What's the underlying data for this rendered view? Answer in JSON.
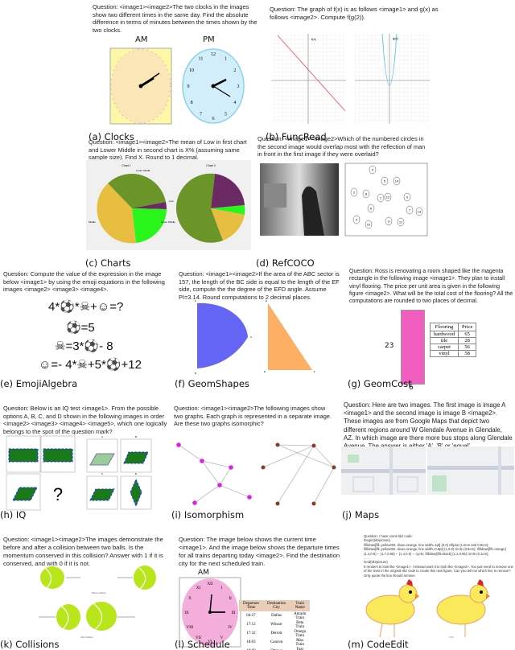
{
  "panels": {
    "clocks": {
      "question": "Question: <image1><image2>The two clocks in the images show two different times in the same day. Find the absolute difference in terms of minutes between the times shown by the two clocks.",
      "label_am": "AM",
      "label_pm": "PM",
      "numbers": [
        "12",
        "1",
        "2",
        "3",
        "4",
        "5",
        "6",
        "7",
        "8",
        "9",
        "10",
        "11"
      ],
      "caption": "(a) Clocks"
    },
    "funcread": {
      "question": "Question: The graph of f(x) is as follows <image1> and g(x) as follows <image2>. Compute f(g(2)).",
      "f_label": "f(x)",
      "g_label": "g(x)",
      "caption": "(b) FuncRead"
    },
    "charts": {
      "question": "Question: <image1><image2>The mean of Low in first chart and Lower Middle in second chart is X% (assuming same sample size). Find X. Round to 1 decimal.",
      "chart1_title": "Chart 1",
      "chart2_title": "Chart 2",
      "labels": [
        "Lower Middle",
        "Low",
        "Upper Middle",
        "Middle"
      ],
      "caption": "(c) Charts"
    },
    "refcoco": {
      "question": "Question: <image1><image2>Which of the numbered circles in the second image would overlap most with the reflection of man in front in the first image if they were overlaid?",
      "circles": [
        "9",
        "5",
        "14",
        "2",
        "8",
        "1",
        "12",
        "0",
        "6",
        "7",
        "13",
        "4",
        "10",
        "3",
        "11"
      ],
      "caption": "(d) RefCOCO"
    },
    "emoji": {
      "question": "Question: Compute the value of the expression in the image below <image1> by using the emoji equations in the following images <image2> <image3> <image4>.",
      "equations": [
        "4*⚽*☠+☺=?",
        "⚽=5",
        "☠=3*⚽- 8",
        "☺=- 4*☠+5*⚽+12"
      ],
      "caption": "(e) EmojiAlgebra"
    },
    "geomshapes": {
      "question": "Question: <image1><image2>If the area of the ABC sector is 157, the length of the BC side is equal to the length of the EF side, compute the the degree of the EFD angle. Assume PI=3.14. Round computations to 2 decimal places.",
      "points": [
        "C",
        "A",
        "B",
        "E",
        "D",
        "F"
      ],
      "caption": "(f) GeomShapes"
    },
    "geomcost": {
      "question": "Question: Ross is renovating a room shaped like the magenta rectangle in the following image <image1>. They plan to install vinyl flooring. The price per unit area is given in the following figure <image2>. What will be the total cost of the flooring? All the computations are rounded to two places of decimal.",
      "height": "23",
      "width": "6",
      "table": {
        "headers": [
          "Flooring",
          "Price"
        ],
        "rows": [
          [
            "hardwood",
            "65"
          ],
          [
            "tile",
            "28"
          ],
          [
            "carpet",
            "56"
          ],
          [
            "vinyl",
            "58"
          ]
        ]
      },
      "caption": "(g) GeomCost"
    },
    "iq": {
      "question": "Question: Below is an IQ test <image1>. From the possible options A, B, C, and D shown in the following images in order <image2> <image3> <image4> <image5>, which one logically belongs to the spot of the question mark?",
      "mark": "?",
      "options": [
        "A",
        "B",
        "C",
        "D"
      ],
      "caption": "(h) IQ"
    },
    "isomorphism": {
      "question": "Question: <image1><image2>The following images show two graphs. Each graph is represented in a separate image. Are these two graphs isomorphic?",
      "caption": "(i) Isomorphism"
    },
    "maps": {
      "question": "Question: Here are two images. The first image is image A <image1> and the second image is image B <image2>. These images are from Google Maps that depict two different regions around W Glendale Avenue in Glendale, AZ. In which image are there more bus stops along Glendale Avenue. The answer is either 'A', 'B' or 'equal'.",
      "caption": "(j) Maps"
    },
    "collisions": {
      "question": "Question: <image1><image2>The images demonstrate the before and after a collision between two balls. Is the momentum conserved in this collision? Answer with 1 if it is conserved, and with 0 if it is not.",
      "before_label": "Before Collision",
      "after_label": "After Collision",
      "caption": "(k) Collisions"
    },
    "schedule": {
      "question": "Question: The image below shows the current time <image1>. And the image below shows the departure times for all trains departing today <image2>. Find the destination city for the next scheduled train.",
      "label_am": "AM",
      "numerals": [
        "XII",
        "I",
        "II",
        "III",
        "IV",
        "V",
        "VI",
        "VII",
        "VIII",
        "IX",
        "X",
        "XI"
      ],
      "table": {
        "headers": [
          "Departure Time",
          "Destination City",
          "Train Name"
        ],
        "rows": [
          [
            "04:27",
            "Dallas",
            "Amarin Train"
          ],
          [
            "17:12",
            "Winsor",
            "Beta Train"
          ],
          [
            "17:32",
            "Detroit",
            "Omega Train"
          ],
          [
            "18:03",
            "Cancun",
            "Max Train"
          ],
          [
            "18:09",
            "Ottawa",
            "Fast Train"
          ],
          [
            "20:21",
            "Montreal",
            "Alpha Train"
          ]
        ]
      },
      "caption": "(l) Schedule"
    },
    "codeedit": {
      "question": "Question: I have some tikz code:",
      "code": [
        "\\begin{tikzpicture}",
        "\\filldraw[fill=yellow!50, draw=orange, line width=1pt] (0,0) ellipse (1.5cm and 0.8cm);",
        "\\filldraw[fill=yellow!50, draw=orange, line width=0.8pt] (1,0.8) circle (0.5cm); \\filldraw[fill=orange] (1.4,0.8) -- (1.7,0.65) -- (1.4,0.5) -- cycle; \\filldraw[fill=black] (1.2,0.95) circle (0.1cm);",
        "......",
        "\\end{tikzpicture}"
      ],
      "ask": "It renders to look like <image1>. I instead want it to look like <image2>. You just need to remove one of the lines in the original tikz code to create this new figure. Can you tell me which line to remove? Only quote the line should remove.",
      "caption": "(m) CodeEdit"
    }
  },
  "colors": {
    "clock_am": "#fbe6b8",
    "clock_pm": "#d2eefa",
    "pie_olive": "#6b9429",
    "pie_gold": "#e8be40",
    "pie_purple": "#6b2a63",
    "pie_green": "#2af51a",
    "sector_blue": "#6464f5",
    "triangle_orange": "#fdb064",
    "magenta": "#f25ebf",
    "tennis": "#b8e61a",
    "chick": "#fbe95c"
  }
}
